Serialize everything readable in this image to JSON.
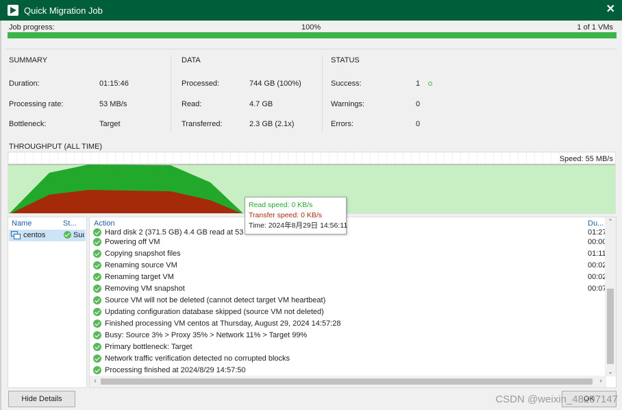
{
  "window": {
    "title": "Quick Migration Job"
  },
  "progress": {
    "label": "Job progress:",
    "percent_text": "100%",
    "percent": 100,
    "count_text": "1 of 1 VMs"
  },
  "summary": {
    "header": "SUMMARY",
    "rows": [
      {
        "label": "Duration:",
        "value": "01:15:46"
      },
      {
        "label": "Processing rate:",
        "value": "53 MB/s"
      },
      {
        "label": "Bottleneck:",
        "value": "Target"
      }
    ]
  },
  "data_section": {
    "header": "DATA",
    "rows": [
      {
        "label": "Processed:",
        "value": "744 GB (100%)"
      },
      {
        "label": "Read:",
        "value": "4.7 GB"
      },
      {
        "label": "Transferred:",
        "value": "2.3 GB (2.1x)"
      }
    ]
  },
  "status": {
    "header": "STATUS",
    "rows": [
      {
        "label": "Success:",
        "value": "1"
      },
      {
        "label": "Warnings:",
        "value": "0"
      },
      {
        "label": "Errors:",
        "value": "0"
      }
    ]
  },
  "throughput": {
    "title": "THROUGHPUT (ALL TIME)",
    "speed_label": "Speed: 55 MB/s",
    "tooltip": {
      "read": "Read speed: 0 KB/s",
      "transfer": "Transfer speed: 0 KB/s",
      "time": "Time: 2024年8月29日 14:56:11"
    },
    "colors": {
      "read": "#22a82a",
      "transfer": "#a52a0a",
      "background": "#c8eec4"
    }
  },
  "vm_list": {
    "headers": {
      "name": "Name",
      "status": "St..."
    },
    "items": [
      {
        "name": "centos",
        "status": "Success"
      }
    ]
  },
  "log": {
    "headers": {
      "action": "Action",
      "duration": "Du..."
    },
    "rows": [
      {
        "text": "Hard disk 2 (371.5 GB) 4.4 GB read at 53 MB/s",
        "duration": "01:27"
      },
      {
        "text": "Powering off VM",
        "duration": "00:00"
      },
      {
        "text": "Copying snapshot files",
        "duration": "01:11"
      },
      {
        "text": "Renaming source VM",
        "duration": "00:02"
      },
      {
        "text": "Renaming target VM",
        "duration": "00:02"
      },
      {
        "text": "Removing VM snapshot",
        "duration": "00:07"
      },
      {
        "text": "Source VM will not be deleted (cannot detect target VM heartbeat)",
        "duration": ""
      },
      {
        "text": "Updating configuration database skipped (source VM not deleted)",
        "duration": ""
      },
      {
        "text": "Finished processing VM centos at Thursday, August 29, 2024 14:57:28",
        "duration": ""
      },
      {
        "text": "Busy: Source 3% > Proxy 35% > Network 11% > Target 99%",
        "duration": ""
      },
      {
        "text": "Primary bottleneck: Target",
        "duration": ""
      },
      {
        "text": "Network traffic verification detected no corrupted blocks",
        "duration": ""
      },
      {
        "text": "Processing finished at 2024/8/29 14:57:50",
        "duration": ""
      }
    ]
  },
  "buttons": {
    "hide_details": "Hide Details",
    "ok": "OK"
  },
  "watermark": "CSDN @weixin_48207147",
  "icons": {
    "app": "veeam-play-icon",
    "close": "close-icon",
    "success": "check-circle-icon",
    "vm": "vm-icon"
  }
}
